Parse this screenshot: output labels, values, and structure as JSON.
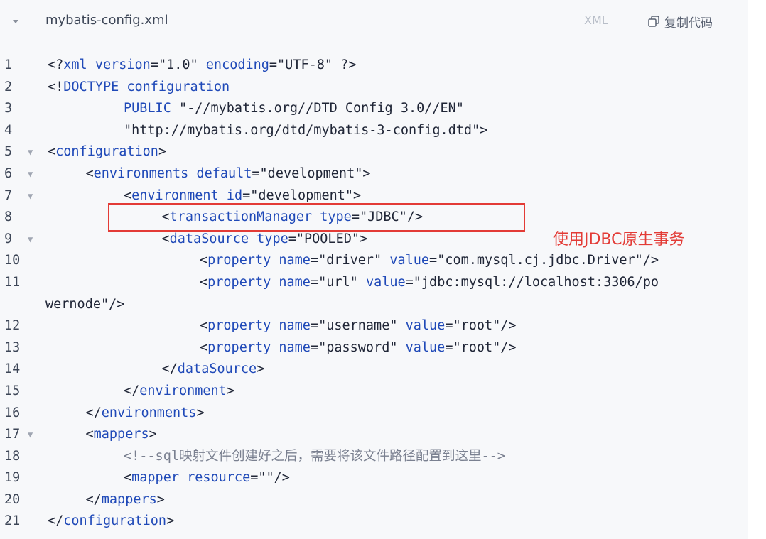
{
  "header": {
    "filename": "mybatis-config.xml",
    "language": "XML",
    "copy_label": "复制代码"
  },
  "annotation": {
    "text": "使用JDBC原生事务",
    "color": "#e33b36"
  },
  "lines": [
    {
      "n": "1",
      "fold": false,
      "indent": 0,
      "html": "<span class='pun'>&lt;?</span><span class='tag'>xml</span> <span class='attr'>version</span><span class='pun'>=</span><span class='str'>\"1.0\"</span> <span class='attr'>encoding</span><span class='pun'>=</span><span class='str'>\"UTF-8\"</span> <span class='pun'>?&gt;</span>"
    },
    {
      "n": "2",
      "fold": false,
      "indent": 0,
      "html": "<span class='pun'>&lt;!</span><span class='tag'>DOCTYPE configuration</span>"
    },
    {
      "n": "3",
      "fold": false,
      "indent": 2,
      "html": "<span class='tag'>PUBLIC</span> <span class='str'>\"-//mybatis.org//DTD Config 3.0//EN\"</span>"
    },
    {
      "n": "4",
      "fold": false,
      "indent": 2,
      "html": "<span class='str'>\"http://mybatis.org/dtd/mybatis-3-config.dtd\"</span><span class='pun'>&gt;</span>"
    },
    {
      "n": "5",
      "fold": true,
      "indent": 0,
      "html": "<span class='pun'>&lt;</span><span class='tag'>configuration</span><span class='pun'>&gt;</span>"
    },
    {
      "n": "6",
      "fold": true,
      "indent": 1,
      "html": "<span class='pun'>&lt;</span><span class='tag'>environments</span> <span class='attr'>default</span><span class='pun'>=</span><span class='str'>\"development\"</span><span class='pun'>&gt;</span>"
    },
    {
      "n": "7",
      "fold": true,
      "indent": 2,
      "html": "<span class='pun'>&lt;</span><span class='tag'>environment</span> <span class='attr'>id</span><span class='pun'>=</span><span class='str'>\"development\"</span><span class='pun'>&gt;</span>"
    },
    {
      "n": "8",
      "fold": false,
      "indent": 3,
      "html": "<span class='pun'>&lt;</span><span class='tag'>transactionManager</span> <span class='attr'>type</span><span class='pun'>=</span><span class='str'>\"JDBC\"</span><span class='pun'>/&gt;</span>"
    },
    {
      "n": "9",
      "fold": true,
      "indent": 3,
      "html": "<span class='pun'>&lt;</span><span class='tag'>dataSource</span> <span class='attr'>type</span><span class='pun'>=</span><span class='str'>\"POOLED\"</span><span class='pun'>&gt;</span>"
    },
    {
      "n": "10",
      "fold": false,
      "indent": 4,
      "html": "<span class='pun'>&lt;</span><span class='tag'>property</span> <span class='attr'>name</span><span class='pun'>=</span><span class='str'>\"driver\"</span> <span class='attr'>value</span><span class='pun'>=</span><span class='str'>\"com.mysql.cj.jdbc.Driver\"</span><span class='pun'>/&gt;</span>"
    },
    {
      "n": "11",
      "fold": false,
      "indent": 4,
      "html": "<span class='pun'>&lt;</span><span class='tag'>property</span> <span class='attr'>name</span><span class='pun'>=</span><span class='str'>\"url\"</span> <span class='attr'>value</span><span class='pun'>=</span><span class='str'>\"jdbc:mysql://localhost:3306/po</span>"
    },
    {
      "n": "",
      "fold": false,
      "indent": -1,
      "html": "<span class='str'>wernode\"</span><span class='pun'>/&gt;</span>"
    },
    {
      "n": "12",
      "fold": false,
      "indent": 4,
      "html": "<span class='pun'>&lt;</span><span class='tag'>property</span> <span class='attr'>name</span><span class='pun'>=</span><span class='str'>\"username\"</span> <span class='attr'>value</span><span class='pun'>=</span><span class='str'>\"root\"</span><span class='pun'>/&gt;</span>"
    },
    {
      "n": "13",
      "fold": false,
      "indent": 4,
      "html": "<span class='pun'>&lt;</span><span class='tag'>property</span> <span class='attr'>name</span><span class='pun'>=</span><span class='str'>\"password\"</span> <span class='attr'>value</span><span class='pun'>=</span><span class='str'>\"root\"</span><span class='pun'>/&gt;</span>"
    },
    {
      "n": "14",
      "fold": false,
      "indent": 3,
      "html": "<span class='pun'>&lt;/</span><span class='tag'>dataSource</span><span class='pun'>&gt;</span>"
    },
    {
      "n": "15",
      "fold": false,
      "indent": 2,
      "html": "<span class='pun'>&lt;/</span><span class='tag'>environment</span><span class='pun'>&gt;</span>"
    },
    {
      "n": "16",
      "fold": false,
      "indent": 1,
      "html": "<span class='pun'>&lt;/</span><span class='tag'>environments</span><span class='pun'>&gt;</span>"
    },
    {
      "n": "17",
      "fold": true,
      "indent": 1,
      "html": "<span class='pun'>&lt;</span><span class='tag'>mappers</span><span class='pun'>&gt;</span>"
    },
    {
      "n": "18",
      "fold": false,
      "indent": 2,
      "html": "<span class='cmt'>&lt;!--sql映射文件创建好之后，需要将该文件路径配置到这里--&gt;</span>"
    },
    {
      "n": "19",
      "fold": false,
      "indent": 2,
      "html": "<span class='pun'>&lt;</span><span class='tag'>mapper</span> <span class='attr'>resource</span><span class='pun'>=</span><span class='str'>\"\"</span><span class='pun'>/&gt;</span>"
    },
    {
      "n": "20",
      "fold": false,
      "indent": 1,
      "html": "<span class='pun'>&lt;/</span><span class='tag'>mappers</span><span class='pun'>&gt;</span>"
    },
    {
      "n": "21",
      "fold": false,
      "indent": 0,
      "html": "<span class='pun'>&lt;/</span><span class='tag'>configuration</span><span class='pun'>&gt;</span>"
    }
  ]
}
